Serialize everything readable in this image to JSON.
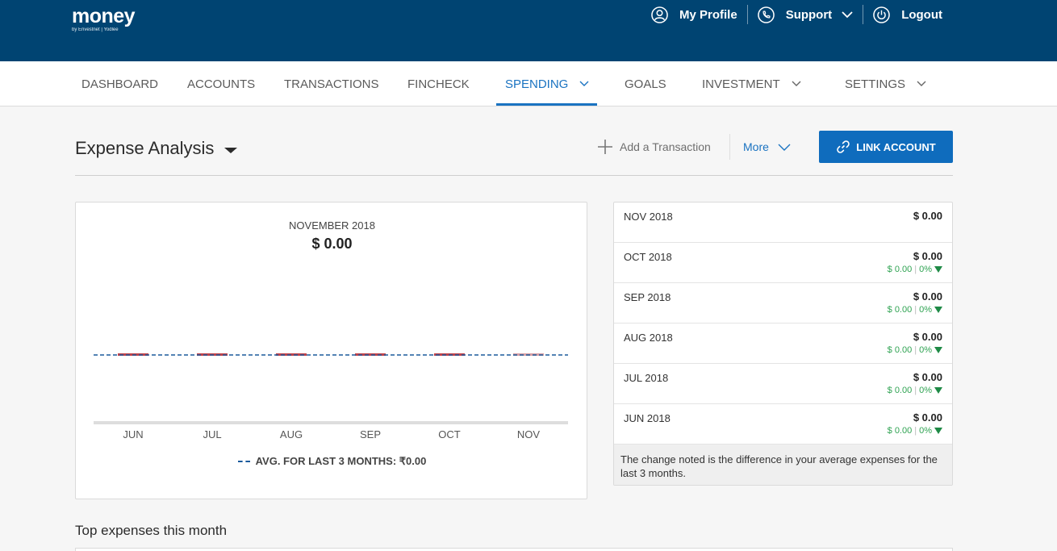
{
  "brand": {
    "name": "money",
    "tagline": "by Envestnet | Yodlee"
  },
  "top_links": [
    {
      "label": "My Profile",
      "icon": "user-circle-icon"
    },
    {
      "label": "Support",
      "icon": "phone-icon"
    },
    {
      "label": "Logout",
      "icon": "power-icon"
    }
  ],
  "nav": [
    {
      "label": "DASHBOARD"
    },
    {
      "label": "ACCOUNTS"
    },
    {
      "label": "TRANSACTIONS"
    },
    {
      "label": "FINCHECK"
    },
    {
      "label": "SPENDING",
      "active": true
    },
    {
      "label": "GOALS"
    },
    {
      "label": "INVESTMENT"
    },
    {
      "label": "SETTINGS"
    }
  ],
  "page": {
    "title": "Expense Analysis",
    "add_transaction": "Add a Transaction",
    "more": "More",
    "link_account": "LINK ACCOUNT"
  },
  "chart": {
    "period": "NOVEMBER 2018",
    "amount": "$ 0.00",
    "legend": "AVG. FOR LAST 3 MONTHS: ₹0.00"
  },
  "chart_data": {
    "type": "bar",
    "categories": [
      "JUN",
      "JUL",
      "AUG",
      "SEP",
      "OCT",
      "NOV"
    ],
    "values": [
      0,
      0,
      0,
      0,
      0,
      0
    ],
    "average": 0,
    "title": "NOVEMBER 2018",
    "legend": [
      "AVG. FOR LAST 3 MONTHS: ₹0.00"
    ],
    "grid": false,
    "colors": {
      "bar": "#c0434b",
      "bar_current": "#d8a0a6",
      "average_line": "#1a5a9c",
      "axis": "#dddddd"
    }
  },
  "months": [
    {
      "label": "NOV 2018",
      "value": "$ 0.00"
    },
    {
      "label": "OCT 2018",
      "value": "$ 0.00",
      "change_amount": "$ 0.00",
      "change_pct": "0%"
    },
    {
      "label": "SEP 2018",
      "value": "$ 0.00",
      "change_amount": "$ 0.00",
      "change_pct": "0%"
    },
    {
      "label": "AUG 2018",
      "value": "$ 0.00",
      "change_amount": "$ 0.00",
      "change_pct": "0%"
    },
    {
      "label": "JUL 2018",
      "value": "$ 0.00",
      "change_amount": "$ 0.00",
      "change_pct": "0%"
    },
    {
      "label": "JUN 2018",
      "value": "$ 0.00",
      "change_amount": "$ 0.00",
      "change_pct": "0%"
    }
  ],
  "month_note": "The change noted is the difference in your average expenses for the last 3 months.",
  "top_expenses_title": "Top expenses this month",
  "colors": {
    "header_bg": "#004472",
    "accent": "#1a73c1",
    "button": "#0f6cbd",
    "positive": "#2fa352"
  }
}
